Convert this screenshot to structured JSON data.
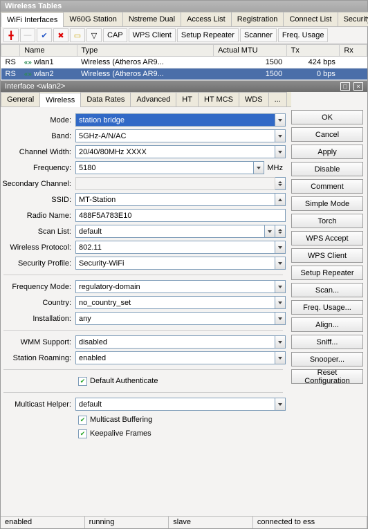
{
  "window_title": "Wireless Tables",
  "main_tabs": [
    "WiFi Interfaces",
    "W60G Station",
    "Nstreme Dual",
    "Access List",
    "Registration",
    "Connect List",
    "Security Profil"
  ],
  "toolbar": {
    "cap": "CAP",
    "wps_client": "WPS Client",
    "setup_repeater": "Setup Repeater",
    "scanner": "Scanner",
    "freq_usage": "Freq. Usage"
  },
  "grid": {
    "headers": [
      "",
      "Name",
      "Type",
      "Actual MTU",
      "Tx",
      "Rx"
    ],
    "rows": [
      {
        "flag": "RS",
        "name": "wlan1",
        "type": "Wireless (Atheros AR9...",
        "mtu": "1500",
        "tx": "424 bps",
        "rx": ""
      },
      {
        "flag": "RS",
        "name": "wlan2",
        "type": "Wireless (Atheros AR9...",
        "mtu": "1500",
        "tx": "0 bps",
        "rx": ""
      }
    ]
  },
  "sub_title": "Interface <wlan2>",
  "sub_tabs": [
    "General",
    "Wireless",
    "Data Rates",
    "Advanced",
    "HT",
    "HT MCS",
    "WDS",
    "..."
  ],
  "form": {
    "mode": {
      "label": "Mode:",
      "value": "station bridge"
    },
    "band": {
      "label": "Band:",
      "value": "5GHz-A/N/AC"
    },
    "chwidth": {
      "label": "Channel Width:",
      "value": "20/40/80MHz XXXX"
    },
    "freq": {
      "label": "Frequency:",
      "value": "5180",
      "unit": "MHz"
    },
    "secchan": {
      "label": "Secondary Channel:",
      "value": ""
    },
    "ssid": {
      "label": "SSID:",
      "value": "MT-Station"
    },
    "radio": {
      "label": "Radio Name:",
      "value": "488F5A783E10"
    },
    "scanlist": {
      "label": "Scan List:",
      "value": "default"
    },
    "wproto": {
      "label": "Wireless Protocol:",
      "value": "802.11"
    },
    "secprof": {
      "label": "Security Profile:",
      "value": "Security-WiFi"
    },
    "freqmode": {
      "label": "Frequency Mode:",
      "value": "regulatory-domain"
    },
    "country": {
      "label": "Country:",
      "value": "no_country_set"
    },
    "install": {
      "label": "Installation:",
      "value": "any"
    },
    "wmm": {
      "label": "WMM Support:",
      "value": "disabled"
    },
    "roaming": {
      "label": "Station Roaming:",
      "value": "enabled"
    },
    "defauth": "Default Authenticate",
    "mhelper": {
      "label": "Multicast Helper:",
      "value": "default"
    },
    "mbuffer": "Multicast Buffering",
    "keepalive": "Keepalive Frames"
  },
  "side": [
    "OK",
    "Cancel",
    "Apply",
    "Disable",
    "Comment",
    "Simple Mode",
    "Torch",
    "WPS Accept",
    "WPS Client",
    "Setup Repeater",
    "Scan...",
    "Freq. Usage...",
    "Align...",
    "Sniff...",
    "Snooper...",
    "Reset Configuration"
  ],
  "status": [
    "enabled",
    "running",
    "slave",
    "connected to ess"
  ]
}
